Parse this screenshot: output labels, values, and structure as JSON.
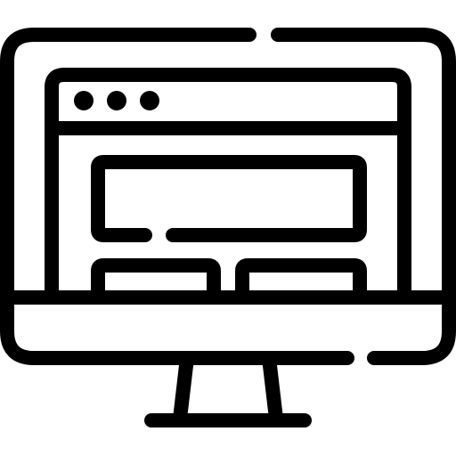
{
  "icon": {
    "name": "desktop-computer-website-layout-icon",
    "style": "line",
    "stroke_color": "#000000",
    "background_color": "#ffffff"
  },
  "parts": [
    "monitor-frame-icon",
    "browser-window-icon",
    "window-control-dots-icon",
    "hero-banner-block-icon",
    "content-card-left-icon",
    "content-card-right-icon",
    "monitor-stand-icon"
  ]
}
